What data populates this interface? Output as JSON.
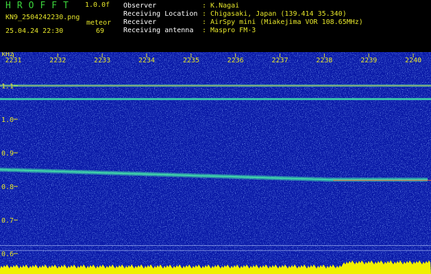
{
  "header": {
    "app_title": "HROFFT",
    "version": "1.0.0f",
    "filename": "KN9_2504242230.png",
    "meteor_label": "meteor",
    "datetime": "25.04.24 22:30",
    "meteor_count": "69",
    "info": [
      {
        "label": "Observer",
        "value": ": K.Nagai"
      },
      {
        "label": "Receiving Location",
        "value": ": Chigasaki, Japan (139.414 35.340)"
      },
      {
        "label": "Receiver",
        "value": ": AirSpy mini (Miakejima VOR 108.65MHz)"
      },
      {
        "label": "Receiving antenna",
        "value": ": Maspro FM-3"
      }
    ]
  },
  "chart_data": {
    "type": "heatmap",
    "y_unit": "kHz",
    "y_ticks": [
      "1.1",
      "1.0",
      "0.9",
      "0.8",
      "0.7",
      "0.6"
    ],
    "y_values": [
      1.1,
      1.0,
      0.9,
      0.8,
      0.7,
      0.6
    ],
    "ylim": [
      0.58,
      1.2
    ],
    "x_ticks": [
      "2231",
      "2232",
      "2233",
      "2234",
      "2235",
      "2236",
      "2237",
      "2238",
      "2239",
      "2240"
    ],
    "x_values": [
      2231,
      2232,
      2233,
      2234,
      2235,
      2236,
      2237,
      2238,
      2239,
      2240
    ],
    "xlim": [
      2230.7,
      2240.4
    ],
    "lines_khz": [
      1.1,
      1.06
    ],
    "colors": {
      "background": "#0a1aa8",
      "noise": "#3a64e0",
      "signal": "#42e0a8",
      "hot": "#ff6a3a",
      "ticks": "#e6e62a",
      "bottom_bar": "#f0f000"
    }
  }
}
